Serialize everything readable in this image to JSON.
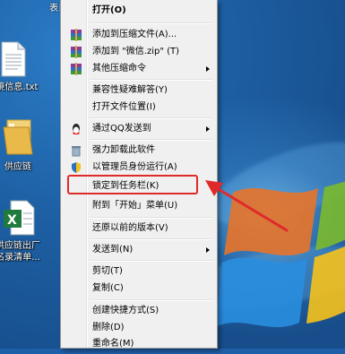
{
  "desktop": {
    "top_text": "表日",
    "icons": [
      {
        "label_line1": "环境信息.txt",
        "label_line2": ""
      },
      {
        "label_line1": "供应链",
        "label_line2": ""
      },
      {
        "label_line1": "供应链出厂",
        "label_line2": "名录清单..."
      }
    ]
  },
  "menu": {
    "items": [
      {
        "label": "打开(O)",
        "icon": ""
      },
      {
        "label": "添加到压缩文件(A)...",
        "icon": "winrar-icon"
      },
      {
        "label": "添加到 \"微信.zip\" (T)",
        "icon": "winrar-icon"
      },
      {
        "label": "其他压缩命令",
        "icon": "winrar-icon"
      },
      {
        "label": "兼容性疑难解答(Y)",
        "icon": ""
      },
      {
        "label": "打开文件位置(I)",
        "icon": ""
      },
      {
        "label": "通过QQ发送到",
        "icon": "qq-icon"
      },
      {
        "label": "强力卸载此软件",
        "icon": "trash-icon"
      },
      {
        "label": "以管理员身份运行(A)",
        "icon": "shield-icon"
      },
      {
        "label": "锁定到任务栏(K)",
        "icon": ""
      },
      {
        "label": "附到「开始」菜单(U)",
        "icon": ""
      },
      {
        "label": "还原以前的版本(V)",
        "icon": ""
      },
      {
        "label": "发送到(N)",
        "icon": ""
      },
      {
        "label": "剪切(T)",
        "icon": ""
      },
      {
        "label": "复制(C)",
        "icon": ""
      },
      {
        "label": "创建快捷方式(S)",
        "icon": ""
      },
      {
        "label": "删除(D)",
        "icon": ""
      },
      {
        "label": "重命名(M)",
        "icon": ""
      }
    ]
  },
  "annotation": {
    "highlight_color": "#e02a2a",
    "highlighted_item": "锁定到任务栏(K)"
  }
}
